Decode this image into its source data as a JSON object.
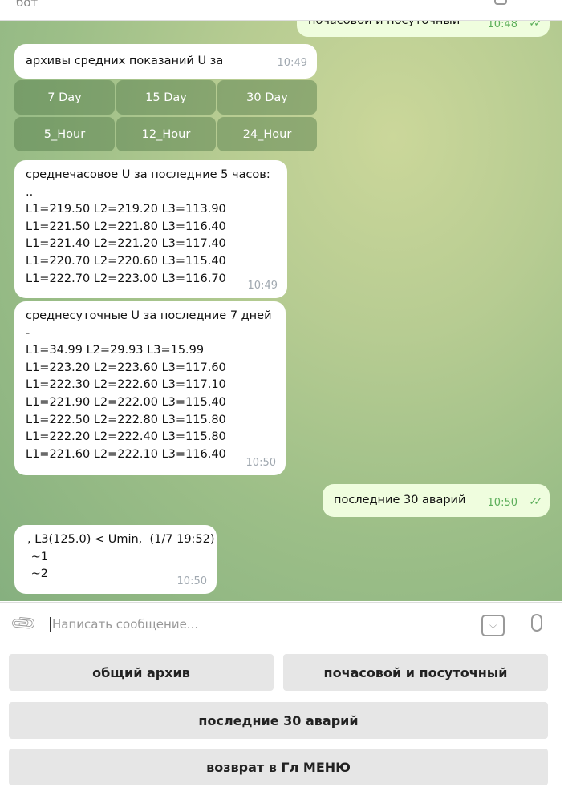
{
  "header": {
    "subtitle": "бот"
  },
  "messages": [
    {
      "dir": "out",
      "text": "почасовой и посуточный",
      "time": "10:48"
    },
    {
      "dir": "in",
      "text": "архивы средних показаний U за",
      "time": "10:49",
      "inline_keyboard": [
        [
          "7 Day",
          "15 Day",
          "30 Day"
        ],
        [
          "5_Hour",
          "12_Hour",
          "24_Hour"
        ]
      ]
    },
    {
      "dir": "in",
      "lines": [
        "среднечасовое U за последние 5 часов:",
        "..",
        "L1=219.50 L2=219.20 L3=113.90",
        "L1=221.50 L2=221.80 L3=116.40",
        "L1=221.40 L2=221.20 L3=117.40",
        "L1=220.70 L2=220.60 L3=115.40",
        "L1=222.70 L2=223.00 L3=116.70"
      ],
      "time": "10:49"
    },
    {
      "dir": "in",
      "lines": [
        "среднесуточные U за последние 7 дней",
        "-",
        "L1=34.99 L2=29.93 L3=15.99",
        "L1=223.20 L2=223.60 L3=117.60",
        "L1=222.30 L2=222.60 L3=117.10",
        "L1=221.90 L2=222.00 L3=115.40",
        "L1=222.50 L2=222.80 L3=115.80",
        "L1=222.20 L2=222.40 L3=115.80",
        "L1=221.60 L2=222.10 L3=116.40"
      ],
      "time": "10:50"
    },
    {
      "dir": "out",
      "text": "последние 30 аварий",
      "time": "10:50"
    },
    {
      "dir": "in",
      "lines": [
        ", L3(125.0) < Umin,  (1/7 19:52)",
        " ~1",
        " ~2"
      ],
      "time": "10:50"
    }
  ],
  "input": {
    "placeholder": "Написать сообщение..."
  },
  "keyboard": [
    [
      "общий архив",
      "почасовой и посуточный"
    ],
    [
      "последние 30 аварий"
    ],
    [
      "возврат в Гл МЕНЮ"
    ]
  ],
  "icons": [
    "paperclip-icon",
    "bot-keyboard-icon",
    "microphone-icon",
    "double-check-icon"
  ],
  "colors": {
    "outgoing_bubble": "#effdde",
    "incoming_bubble": "#ffffff",
    "check": "#5cae5a"
  }
}
